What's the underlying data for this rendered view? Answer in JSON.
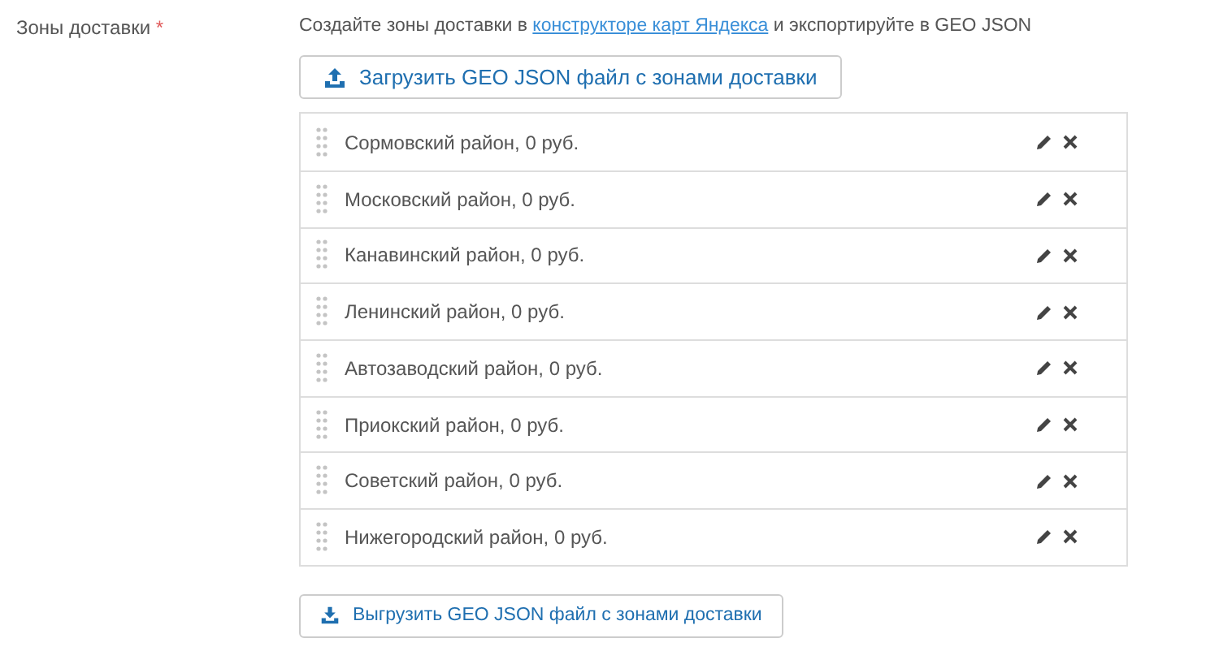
{
  "field": {
    "label": "Зоны доставки",
    "required_mark": "*"
  },
  "help": {
    "before": "Создайте зоны доставки в",
    "link": "конструкторе карт Яндекса",
    "after": "и экспортируйте в GEO JSON"
  },
  "upload_button": "Загрузить GEO JSON файл с зонами доставки",
  "zones": [
    {
      "name": "Сормовский район, 0 руб."
    },
    {
      "name": "Московский район, 0 руб."
    },
    {
      "name": "Канавинский район, 0 руб."
    },
    {
      "name": "Ленинский район, 0 руб."
    },
    {
      "name": "Автозаводский район, 0 руб."
    },
    {
      "name": "Приокский район, 0 руб."
    },
    {
      "name": "Советский район, 0 руб."
    },
    {
      "name": "Нижегородский район, 0 руб."
    }
  ],
  "download_button": "Выгрузить GEO JSON файл с зонами доставки"
}
